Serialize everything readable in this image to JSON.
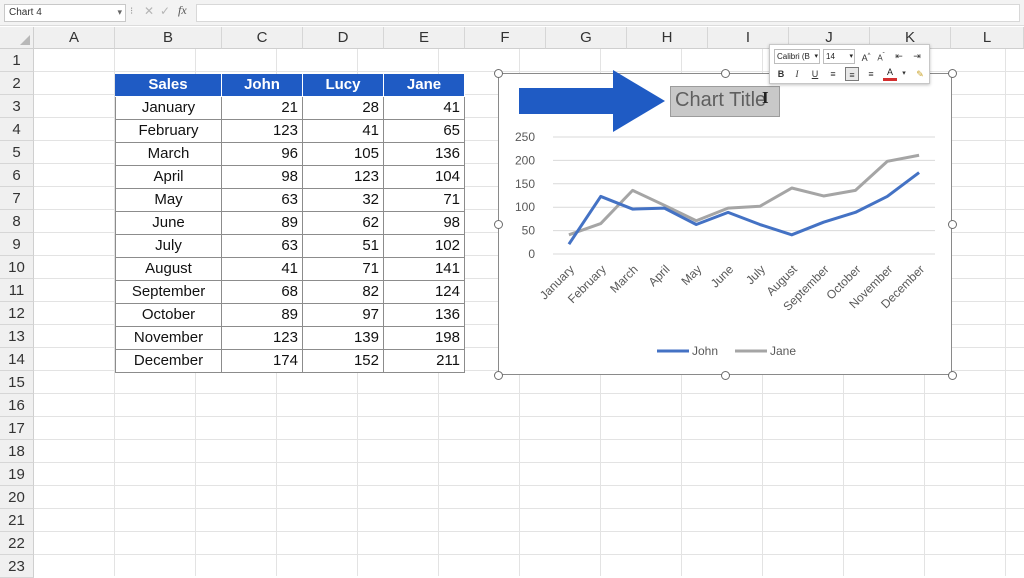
{
  "formula_bar": {
    "name_box": "Chart 4",
    "fx_label": "fx",
    "cancel_icon": "✕",
    "enter_icon": "✓"
  },
  "columns": [
    "A",
    "B",
    "C",
    "D",
    "E",
    "F",
    "G",
    "H",
    "I",
    "J",
    "K",
    "L"
  ],
  "rows": [
    "1",
    "2",
    "3",
    "4",
    "5",
    "6",
    "7",
    "8",
    "9",
    "10",
    "11",
    "12",
    "13",
    "14",
    "15",
    "16",
    "17",
    "18",
    "19",
    "20",
    "21",
    "22",
    "23"
  ],
  "table": {
    "headers": [
      "Sales",
      "John",
      "Lucy",
      "Jane"
    ],
    "rows": [
      {
        "month": "January",
        "john": "21",
        "lucy": "28",
        "jane": "41"
      },
      {
        "month": "February",
        "john": "123",
        "lucy": "41",
        "jane": "65"
      },
      {
        "month": "March",
        "john": "96",
        "lucy": "105",
        "jane": "136"
      },
      {
        "month": "April",
        "john": "98",
        "lucy": "123",
        "jane": "104"
      },
      {
        "month": "May",
        "john": "63",
        "lucy": "32",
        "jane": "71"
      },
      {
        "month": "June",
        "john": "89",
        "lucy": "62",
        "jane": "98"
      },
      {
        "month": "July",
        "john": "63",
        "lucy": "51",
        "jane": "102"
      },
      {
        "month": "August",
        "john": "41",
        "lucy": "71",
        "jane": "141"
      },
      {
        "month": "September",
        "john": "68",
        "lucy": "82",
        "jane": "124"
      },
      {
        "month": "October",
        "john": "89",
        "lucy": "97",
        "jane": "136"
      },
      {
        "month": "November",
        "john": "123",
        "lucy": "139",
        "jane": "198"
      },
      {
        "month": "December",
        "john": "174",
        "lucy": "152",
        "jane": "211"
      }
    ]
  },
  "mini_toolbar": {
    "font": "Calibri (B",
    "size": "14",
    "buttons": [
      "B",
      "I",
      "U",
      "A",
      "A"
    ]
  },
  "colors": {
    "accent": "#1f5bc4",
    "john": "#4472c4",
    "jane": "#a5a5a5"
  },
  "chart_data": {
    "type": "line",
    "title": "Chart Title",
    "categories": [
      "January",
      "February",
      "March",
      "April",
      "May",
      "June",
      "July",
      "August",
      "September",
      "October",
      "November",
      "December"
    ],
    "series": [
      {
        "name": "John",
        "values": [
          21,
          123,
          96,
          98,
          63,
          89,
          63,
          41,
          68,
          89,
          123,
          174
        ]
      },
      {
        "name": "Jane",
        "values": [
          41,
          65,
          136,
          104,
          71,
          98,
          102,
          141,
          124,
          136,
          198,
          211
        ]
      }
    ],
    "ylim": [
      0,
      250
    ],
    "yticks": [
      0,
      50,
      100,
      150,
      200,
      250
    ],
    "grid": true,
    "legend": "bottom"
  }
}
